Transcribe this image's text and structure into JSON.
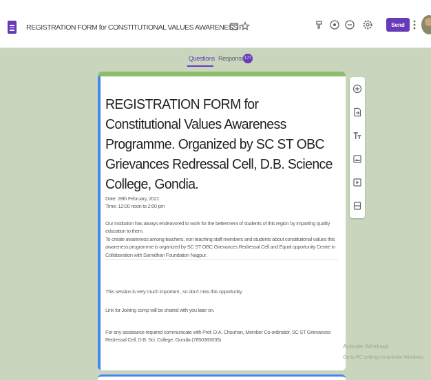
{
  "header": {
    "doc_title": "REGISTRATION FORM for CONSTITUTIONAL VALUES AWARENESS PROGF",
    "send_label": "Send",
    "icons": [
      "folder-icon",
      "star-icon",
      "customize-theme-icon",
      "preview-eye-icon",
      "undo-icon",
      "settings-icon",
      "more-vert-icon"
    ]
  },
  "tabs": {
    "questions_label": "Questions",
    "responses_label": "Responses",
    "responses_count": "177"
  },
  "form": {
    "title": "REGISTRATION FORM for Constitutional Values Awareness Programme. Organized by SC ST OBC Grievances Redressal Cell, D.B. Science College, Gondia.",
    "date_line": "Date: 28th February, 2021",
    "time_line": "Time: 12:00 noon to 2:00 pm",
    "para1": "Our institution has always endeavored to work for the betterment of students of this region by imparting quality education to them.",
    "para2": "To create awareness among teachers, non teaching staff members and students about constitutional values this awareness programme is organized by SC ST OBC Grievances Redressal Cell and Equal opportunity Centre in Collaboration with Samidhan Foundation Nagpur.",
    "para3": "This session is very much important , so don't miss this opportunity.",
    "para4": "Link for Joining comp will be shared with you later on.",
    "para5": "For any assistance required communicate with Prof. D.A. Chouhan, Member Co-ordinator, SC ST Grievances Redressal Cell, D.B. Sci. College, Gondia (7850383035)"
  },
  "side_toolbar": {
    "icons": [
      "add-question-icon",
      "import-questions-icon",
      "add-title-icon",
      "add-image-icon",
      "add-video-icon",
      "add-section-icon"
    ]
  },
  "watermark": {
    "line1": "Activate Windows",
    "line2": "Go to PC settings to activate Windows."
  },
  "colors": {
    "accent": "#673ab7",
    "background": "#c9d6bd",
    "card_header": "#8bbd6a",
    "focus_bar": "#4285f4"
  }
}
